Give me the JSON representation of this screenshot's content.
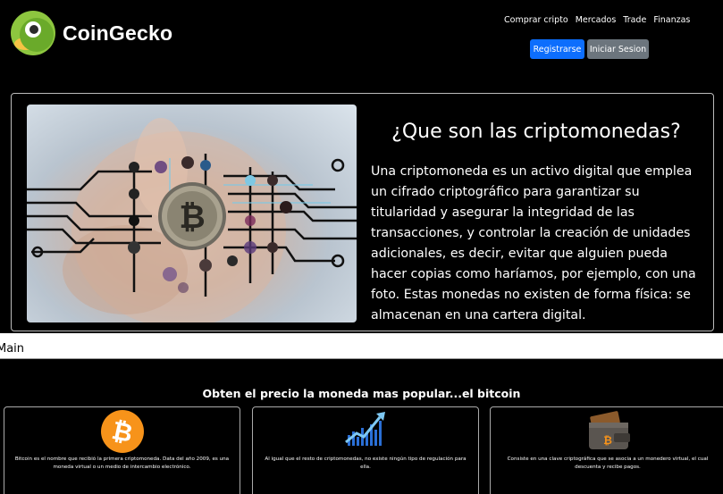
{
  "header": {
    "brand": "CoinGecko",
    "nav": [
      "Comprar cripto",
      "Mercados",
      "Trade",
      "Finanzas"
    ],
    "register_label": "Registrarse",
    "login_label": "Iniciar Sesion"
  },
  "hero": {
    "title": "¿Que son las criptomonedas?",
    "text": "Una criptomoneda es un activo digital que emplea un cifrado criptográfico para garantizar su titularidad y asegurar la integridad de las transacciones, y controlar la creación de unidades adicionales, es decir, evitar que alguien pueda hacer copias como haríamos, por ejemplo, con una foto. Estas monedas no existen de forma física: se almacenan en una cartera digital."
  },
  "main_label": "Main",
  "section": {
    "title": "Obten el precio la moneda mas popular...el bitcoin",
    "cards": [
      {
        "icon": "bitcoin-icon",
        "text": "Bitcoin es el nombre que recibió la primera criptomoneda. Data del año 2009, es una moneda virtual o un medio de intercambio electrónico."
      },
      {
        "icon": "chart-icon",
        "text": "Al igual que el resto de criptomonedas, no existe ningún tipo de regulación para ella."
      },
      {
        "icon": "wallet-icon",
        "text": "Consiste en una clave criptográfica que se asocia a un monedero virtual, el cual descuenta y recibe pagos."
      }
    ]
  },
  "colors": {
    "primary_button": "#0d6efd",
    "secondary_button": "#6c757d",
    "bitcoin_orange": "#f7931a",
    "logo_green": "#8dc63f"
  }
}
